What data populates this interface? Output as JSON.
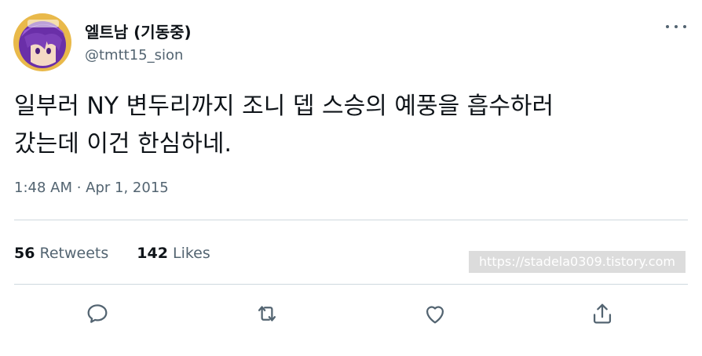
{
  "tweet": {
    "author_name": "엘트남 (기동중)",
    "author_handle": "@tmtt15_sion",
    "text_line1": "일부러 NY 변두리까지 조니 뎁 스승의 예풍을 흡수하러",
    "text_line2": "갔는데 이건 한심하네.",
    "timestamp": "1:48 AM · Apr 1, 2015",
    "retweets_count": "56",
    "retweets_label": "Retweets",
    "likes_count": "142",
    "likes_label": "Likes"
  },
  "watermark": {
    "text": "https://stadela0309.tistory.com"
  },
  "icons": {
    "more": "more-horizontal-icon",
    "reply": "reply-icon",
    "retweet": "retweet-icon",
    "like": "heart-icon",
    "share": "share-icon"
  },
  "colors": {
    "text_primary": "#0f1419",
    "text_secondary": "#536471",
    "divider": "#cfd9de",
    "avatar_hair": "#7b3fb8"
  }
}
